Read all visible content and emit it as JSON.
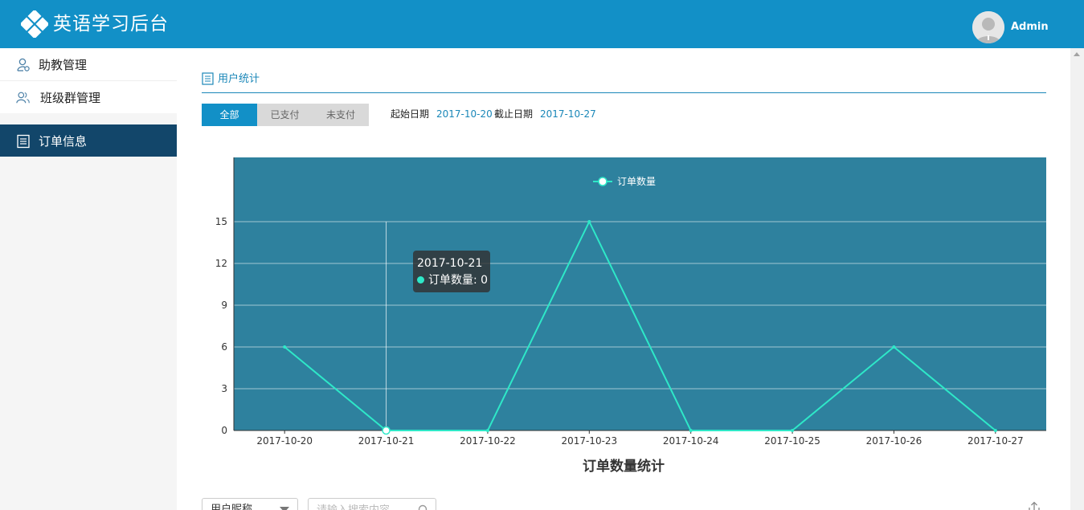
{
  "header": {
    "title": "英语学习后台",
    "user_name": "Admin"
  },
  "sidebar": {
    "items": [
      {
        "label": "助教管理",
        "icon": "assistant-icon"
      },
      {
        "label": "班级群管理",
        "icon": "group-icon"
      },
      {
        "label": "订单信息",
        "icon": "order-icon",
        "active": true
      }
    ]
  },
  "section": {
    "title": "用户统计"
  },
  "filters": {
    "status_options": [
      "全部",
      "已支付",
      "未支付"
    ],
    "selected_status": "全部",
    "start_label": "起始日期",
    "start_value": "2017-10-20",
    "end_label": "截止日期",
    "end_value": "2017-10-27"
  },
  "chart_data": {
    "type": "line",
    "title": "订单数量统计",
    "categories": [
      "2017-10-20",
      "2017-10-21",
      "2017-10-22",
      "2017-10-23",
      "2017-10-24",
      "2017-10-25",
      "2017-10-26",
      "2017-10-27"
    ],
    "series": [
      {
        "name": "订单数量",
        "values": [
          6,
          0,
          0,
          15,
          0,
          0,
          6,
          0
        ],
        "color": "#2ee8c8"
      }
    ],
    "ylim": [
      0,
      15
    ],
    "yticks": [
      0,
      3,
      6,
      9,
      12,
      15
    ],
    "grid": true,
    "legend": "top-center",
    "plot_background": "#2e819e",
    "tooltip": {
      "date": "2017-10-21",
      "series": "订单数量",
      "value": 0,
      "text": "订单数量: 0"
    }
  },
  "table_filter": {
    "field_select": "用户昵称",
    "search_placeholder": "请输入搜索内容"
  },
  "colors": {
    "header": "#1290c7",
    "sidebar_active": "#12466a",
    "accent": "#1a87b8",
    "line": "#2ee8c8"
  }
}
